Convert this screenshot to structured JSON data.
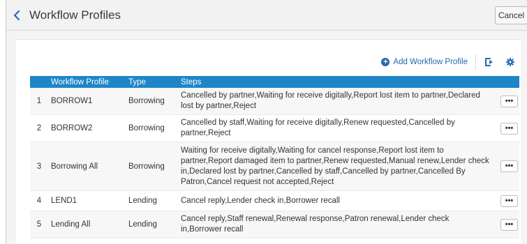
{
  "header": {
    "title": "Workflow Profiles",
    "cancel_label": "Cancel"
  },
  "toolbar": {
    "add_label": "Add Workflow Profile"
  },
  "table": {
    "columns": [
      "",
      "Workflow Profile",
      "Type",
      "Steps",
      ""
    ],
    "rows": [
      {
        "num": "1",
        "profile": "BORROW1",
        "type": "Borrowing",
        "steps": "Cancelled by partner,Waiting for receive digitally,Report lost item to partner,Declared lost by partner,Reject",
        "action": "•••"
      },
      {
        "num": "2",
        "profile": "BORROW2",
        "type": "Borrowing",
        "steps": "Cancelled by staff,Waiting for receive digitally,Renew requested,Cancelled by partner,Reject",
        "action": "•••"
      },
      {
        "num": "3",
        "profile": "Borrowing All",
        "type": "Borrowing",
        "steps": "Waiting for receive digitally,Waiting for cancel response,Report lost item to partner,Report damaged item to partner,Renew requested,Manual renew,Lender check in,Declared lost by partner,Cancelled by staff,Cancelled by partner,Cancelled By Patron,Cancel request not accepted,Reject",
        "action": "•••"
      },
      {
        "num": "4",
        "profile": "LEND1",
        "type": "Lending",
        "steps": "Cancel reply,Lender check in,Borrower recall",
        "action": "•••"
      },
      {
        "num": "5",
        "profile": "Lending All",
        "type": "Lending",
        "steps": "Cancel reply,Staff renewal,Renewal response,Patron renewal,Lender check in,Borrower recall",
        "action": "•••"
      }
    ]
  },
  "colors": {
    "accent": "#1e86c8",
    "link": "#2468b2"
  },
  "icons": {
    "back": "chevron-left-icon",
    "add": "plus-circle-icon",
    "export": "export-icon",
    "settings": "gear-icon"
  }
}
